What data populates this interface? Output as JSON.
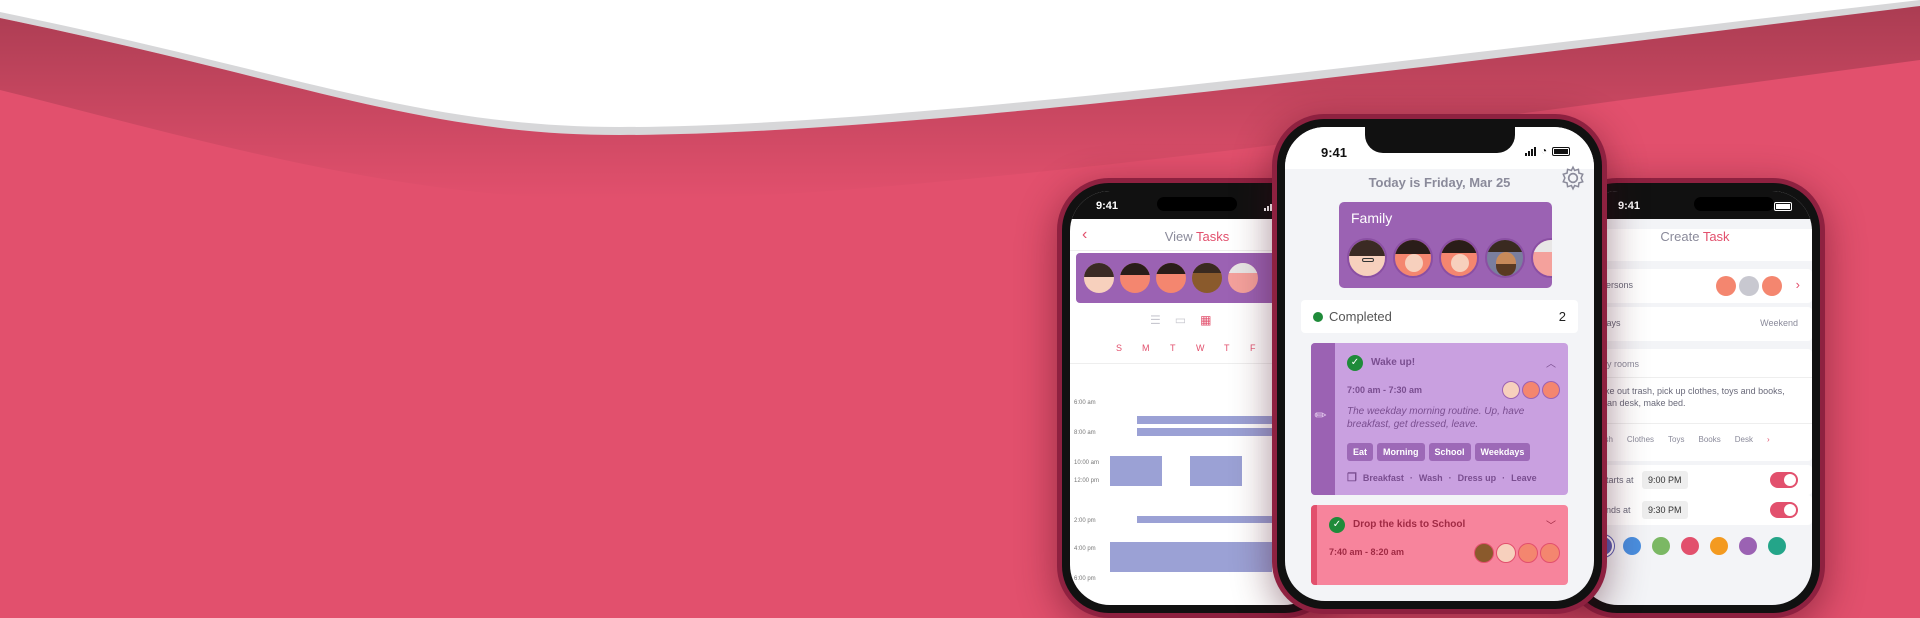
{
  "colors": {
    "background": "#e2506d",
    "wave": "#ffffff",
    "accent": "#e2506d",
    "family_purple": "#9b62b3",
    "task_purple": "#c9a0e0",
    "task_pink": "#f7849c"
  },
  "left_phone": {
    "time": "9:41",
    "title_prefix": "View ",
    "title_accent": "Tasks",
    "weekdays": [
      "S",
      "M",
      "T",
      "W",
      "T",
      "F"
    ],
    "time_labels": [
      "6:00 am",
      "8:00 am",
      "10:00 am",
      "12:00 pm",
      "2:00 pm",
      "4:00 pm",
      "6:00 pm"
    ]
  },
  "center_phone": {
    "time": "9:41",
    "date_heading": "Today is Friday, Mar 25",
    "family_title": "Family",
    "completed_label": "Completed",
    "completed_count": "2",
    "task1": {
      "title": "Wake up!",
      "time": "7:00 am - 7:30 am",
      "description": "The weekday morning routine. Up, have breakfast, get dressed, leave.",
      "tags": [
        "Eat",
        "Morning",
        "School",
        "Weekdays"
      ],
      "steps": [
        "Breakfast",
        "Wash",
        "Dress up",
        "Leave"
      ]
    },
    "task2": {
      "title": "Drop the kids to School",
      "time": "7:40 am - 8:20 am"
    }
  },
  "right_phone": {
    "time": "9:41",
    "title_prefix": "Create ",
    "title_accent": "Task",
    "persons_label": "Persons",
    "days_label": "Days",
    "days_value": "Weekend",
    "task_name": "idy rooms",
    "task_description": "ake out trash, pick up clothes, toys and books, lean desk, make bed.",
    "tags": [
      "ash",
      "Clothes",
      "Toys",
      "Books",
      "Desk"
    ],
    "starts_label": "Starts at",
    "starts_value": "9:00 PM",
    "ends_label": "Ends at",
    "ends_value": "9:30 PM",
    "palette": [
      "#5a5fb3",
      "#4a8fe0",
      "#7bb864",
      "#e2506d",
      "#f39a20",
      "#9b62b3",
      "#24a589"
    ]
  }
}
